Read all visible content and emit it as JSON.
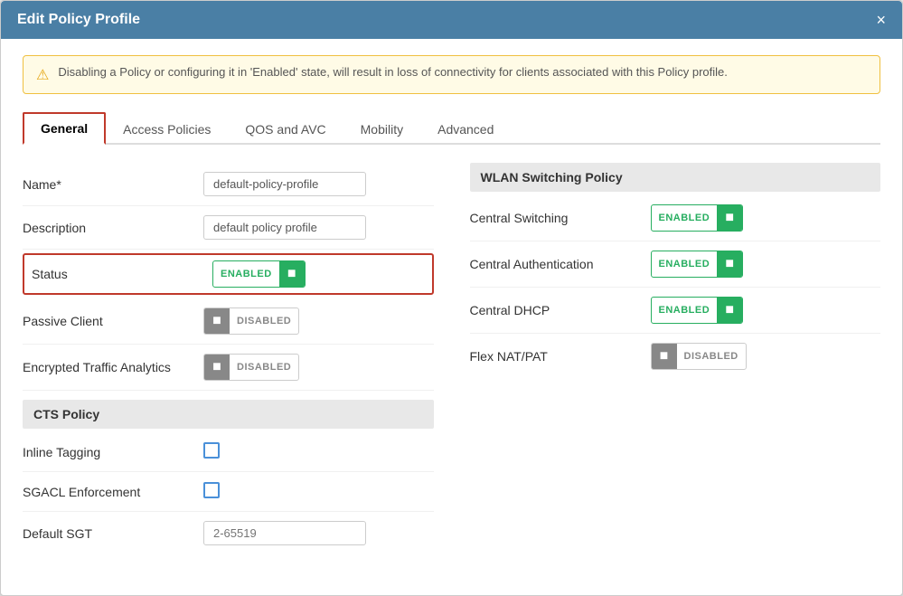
{
  "modal": {
    "title": "Edit Policy Profile",
    "close_label": "×"
  },
  "warning": {
    "text": "Disabling a Policy or configuring it in 'Enabled' state, will result in loss of connectivity for clients associated with this Policy profile."
  },
  "tabs": [
    {
      "id": "general",
      "label": "General",
      "active": true
    },
    {
      "id": "access-policies",
      "label": "Access Policies",
      "active": false
    },
    {
      "id": "qos-avc",
      "label": "QOS and AVC",
      "active": false
    },
    {
      "id": "mobility",
      "label": "Mobility",
      "active": false
    },
    {
      "id": "advanced",
      "label": "Advanced",
      "active": false
    }
  ],
  "left": {
    "fields": [
      {
        "id": "name",
        "label": "Name*",
        "type": "text-input",
        "value": "default-policy-profile"
      },
      {
        "id": "description",
        "label": "Description",
        "type": "text-input",
        "value": "default policy profile"
      },
      {
        "id": "status",
        "label": "Status",
        "type": "toggle-enabled",
        "value": "ENABLED",
        "highlighted": true
      },
      {
        "id": "passive-client",
        "label": "Passive Client",
        "type": "toggle-disabled",
        "value": "DISABLED"
      },
      {
        "id": "encrypted-traffic",
        "label": "Encrypted Traffic Analytics",
        "type": "toggle-disabled",
        "value": "DISABLED"
      }
    ],
    "cts_section": {
      "title": "CTS Policy",
      "fields": [
        {
          "id": "inline-tagging",
          "label": "Inline Tagging",
          "type": "checkbox"
        },
        {
          "id": "sgacl-enforcement",
          "label": "SGACL Enforcement",
          "type": "checkbox"
        },
        {
          "id": "default-sgt",
          "label": "Default SGT",
          "type": "text-input",
          "placeholder": "2-65519",
          "value": ""
        }
      ]
    }
  },
  "right": {
    "section_title": "WLAN Switching Policy",
    "fields": [
      {
        "id": "central-switching",
        "label": "Central Switching",
        "type": "toggle-enabled",
        "value": "ENABLED"
      },
      {
        "id": "central-authentication",
        "label": "Central Authentication",
        "type": "toggle-enabled",
        "value": "ENABLED"
      },
      {
        "id": "central-dhcp",
        "label": "Central DHCP",
        "type": "toggle-enabled",
        "value": "ENABLED"
      },
      {
        "id": "flex-nat-pat",
        "label": "Flex NAT/PAT",
        "type": "toggle-disabled",
        "value": "DISABLED"
      }
    ]
  }
}
